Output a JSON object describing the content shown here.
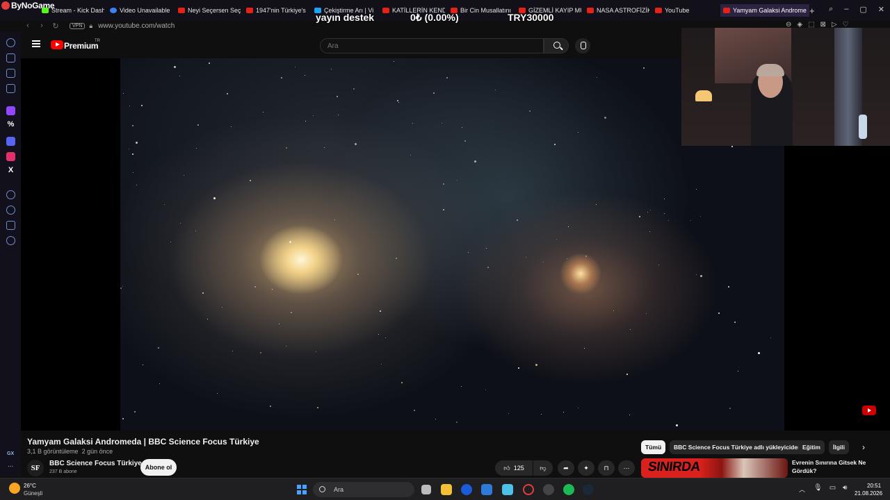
{
  "browser": {
    "brand": "ByNoGame",
    "tabs": [
      {
        "label": "Stream - Kick Dash",
        "icon": "kick-icon"
      },
      {
        "label": "Video Unavailable",
        "icon": "blue-circle-icon"
      },
      {
        "label": "Neyi Seçersen Seç",
        "icon": "youtube-icon"
      },
      {
        "label": "1947'nin Türkiye's",
        "icon": "youtube-icon"
      },
      {
        "label": "Çekiştirme Arı | Vi",
        "icon": "v-icon"
      },
      {
        "label": "KATİLLERİN KENDİ",
        "icon": "youtube-icon"
      },
      {
        "label": "Bir Cin Musallatını",
        "icon": "youtube-icon"
      },
      {
        "label": "GİZEMLİ KAYIP MU",
        "icon": "youtube-icon"
      },
      {
        "label": "NASA ASTROFİZİK",
        "icon": "youtube-icon"
      },
      {
        "label": "YouTube",
        "icon": "youtube-icon"
      },
      {
        "label": "Yamyam Galaksi Andromed",
        "icon": "youtube-icon"
      }
    ],
    "new_tab": "+",
    "url": "www.youtube.com/watch",
    "vpn_label": "VPN"
  },
  "overlay": {
    "goal_label": "yayın destek",
    "goal_progress": "0₺ (0.00%)",
    "goal_target": "TRY30000"
  },
  "youtube": {
    "logo_text": "Premium",
    "logo_region": "TR",
    "search_placeholder": "Ara",
    "video": {
      "title": "Yamyam Galaksi Andromeda | BBC Science Focus Türkiye",
      "views": "3,1 B görüntüleme",
      "age": "2 gün önce",
      "channel_initials": "SF",
      "channel_name": "BBC Science Focus Türkiye",
      "subscribers": "237 B abone",
      "subscribe_label": "Abone ol",
      "like_count": "125"
    },
    "chips": [
      "Tümü",
      "BBC Science Focus Türkiye adlı yükleyiciden",
      "Eğitim",
      "İlgili"
    ],
    "recommendation": {
      "thumb_text": "SINIRDA",
      "title": "Evrenin Sınırına Gitsek Ne Gördük?"
    }
  },
  "sidebar": {
    "gx_label": "GX",
    "more": "..."
  },
  "taskbar": {
    "weather_temp": "26°C",
    "weather_desc": "Güneşli",
    "search_placeholder": "Ara",
    "time": "20:51",
    "date": "21.08.2026"
  },
  "colors": {
    "accent": "#ff0000",
    "background": "#0f0f0f",
    "browser_chrome": "#121019",
    "sidebar_icon": "#6f8fd6"
  }
}
